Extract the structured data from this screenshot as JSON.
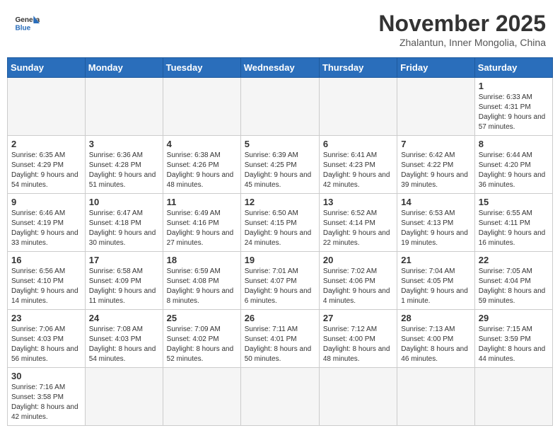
{
  "header": {
    "logo_general": "General",
    "logo_blue": "Blue",
    "month_title": "November 2025",
    "location": "Zhalantun, Inner Mongolia, China"
  },
  "days_of_week": [
    "Sunday",
    "Monday",
    "Tuesday",
    "Wednesday",
    "Thursday",
    "Friday",
    "Saturday"
  ],
  "weeks": [
    [
      {
        "day": "",
        "info": ""
      },
      {
        "day": "",
        "info": ""
      },
      {
        "day": "",
        "info": ""
      },
      {
        "day": "",
        "info": ""
      },
      {
        "day": "",
        "info": ""
      },
      {
        "day": "",
        "info": ""
      },
      {
        "day": "1",
        "info": "Sunrise: 6:33 AM\nSunset: 4:31 PM\nDaylight: 9 hours and 57 minutes."
      }
    ],
    [
      {
        "day": "2",
        "info": "Sunrise: 6:35 AM\nSunset: 4:29 PM\nDaylight: 9 hours and 54 minutes."
      },
      {
        "day": "3",
        "info": "Sunrise: 6:36 AM\nSunset: 4:28 PM\nDaylight: 9 hours and 51 minutes."
      },
      {
        "day": "4",
        "info": "Sunrise: 6:38 AM\nSunset: 4:26 PM\nDaylight: 9 hours and 48 minutes."
      },
      {
        "day": "5",
        "info": "Sunrise: 6:39 AM\nSunset: 4:25 PM\nDaylight: 9 hours and 45 minutes."
      },
      {
        "day": "6",
        "info": "Sunrise: 6:41 AM\nSunset: 4:23 PM\nDaylight: 9 hours and 42 minutes."
      },
      {
        "day": "7",
        "info": "Sunrise: 6:42 AM\nSunset: 4:22 PM\nDaylight: 9 hours and 39 minutes."
      },
      {
        "day": "8",
        "info": "Sunrise: 6:44 AM\nSunset: 4:20 PM\nDaylight: 9 hours and 36 minutes."
      }
    ],
    [
      {
        "day": "9",
        "info": "Sunrise: 6:46 AM\nSunset: 4:19 PM\nDaylight: 9 hours and 33 minutes."
      },
      {
        "day": "10",
        "info": "Sunrise: 6:47 AM\nSunset: 4:18 PM\nDaylight: 9 hours and 30 minutes."
      },
      {
        "day": "11",
        "info": "Sunrise: 6:49 AM\nSunset: 4:16 PM\nDaylight: 9 hours and 27 minutes."
      },
      {
        "day": "12",
        "info": "Sunrise: 6:50 AM\nSunset: 4:15 PM\nDaylight: 9 hours and 24 minutes."
      },
      {
        "day": "13",
        "info": "Sunrise: 6:52 AM\nSunset: 4:14 PM\nDaylight: 9 hours and 22 minutes."
      },
      {
        "day": "14",
        "info": "Sunrise: 6:53 AM\nSunset: 4:13 PM\nDaylight: 9 hours and 19 minutes."
      },
      {
        "day": "15",
        "info": "Sunrise: 6:55 AM\nSunset: 4:11 PM\nDaylight: 9 hours and 16 minutes."
      }
    ],
    [
      {
        "day": "16",
        "info": "Sunrise: 6:56 AM\nSunset: 4:10 PM\nDaylight: 9 hours and 14 minutes."
      },
      {
        "day": "17",
        "info": "Sunrise: 6:58 AM\nSunset: 4:09 PM\nDaylight: 9 hours and 11 minutes."
      },
      {
        "day": "18",
        "info": "Sunrise: 6:59 AM\nSunset: 4:08 PM\nDaylight: 9 hours and 8 minutes."
      },
      {
        "day": "19",
        "info": "Sunrise: 7:01 AM\nSunset: 4:07 PM\nDaylight: 9 hours and 6 minutes."
      },
      {
        "day": "20",
        "info": "Sunrise: 7:02 AM\nSunset: 4:06 PM\nDaylight: 9 hours and 4 minutes."
      },
      {
        "day": "21",
        "info": "Sunrise: 7:04 AM\nSunset: 4:05 PM\nDaylight: 9 hours and 1 minute."
      },
      {
        "day": "22",
        "info": "Sunrise: 7:05 AM\nSunset: 4:04 PM\nDaylight: 8 hours and 59 minutes."
      }
    ],
    [
      {
        "day": "23",
        "info": "Sunrise: 7:06 AM\nSunset: 4:03 PM\nDaylight: 8 hours and 56 minutes."
      },
      {
        "day": "24",
        "info": "Sunrise: 7:08 AM\nSunset: 4:03 PM\nDaylight: 8 hours and 54 minutes."
      },
      {
        "day": "25",
        "info": "Sunrise: 7:09 AM\nSunset: 4:02 PM\nDaylight: 8 hours and 52 minutes."
      },
      {
        "day": "26",
        "info": "Sunrise: 7:11 AM\nSunset: 4:01 PM\nDaylight: 8 hours and 50 minutes."
      },
      {
        "day": "27",
        "info": "Sunrise: 7:12 AM\nSunset: 4:00 PM\nDaylight: 8 hours and 48 minutes."
      },
      {
        "day": "28",
        "info": "Sunrise: 7:13 AM\nSunset: 4:00 PM\nDaylight: 8 hours and 46 minutes."
      },
      {
        "day": "29",
        "info": "Sunrise: 7:15 AM\nSunset: 3:59 PM\nDaylight: 8 hours and 44 minutes."
      }
    ],
    [
      {
        "day": "30",
        "info": "Sunrise: 7:16 AM\nSunset: 3:58 PM\nDaylight: 8 hours and 42 minutes."
      },
      {
        "day": "",
        "info": ""
      },
      {
        "day": "",
        "info": ""
      },
      {
        "day": "",
        "info": ""
      },
      {
        "day": "",
        "info": ""
      },
      {
        "day": "",
        "info": ""
      },
      {
        "day": "",
        "info": ""
      }
    ]
  ]
}
